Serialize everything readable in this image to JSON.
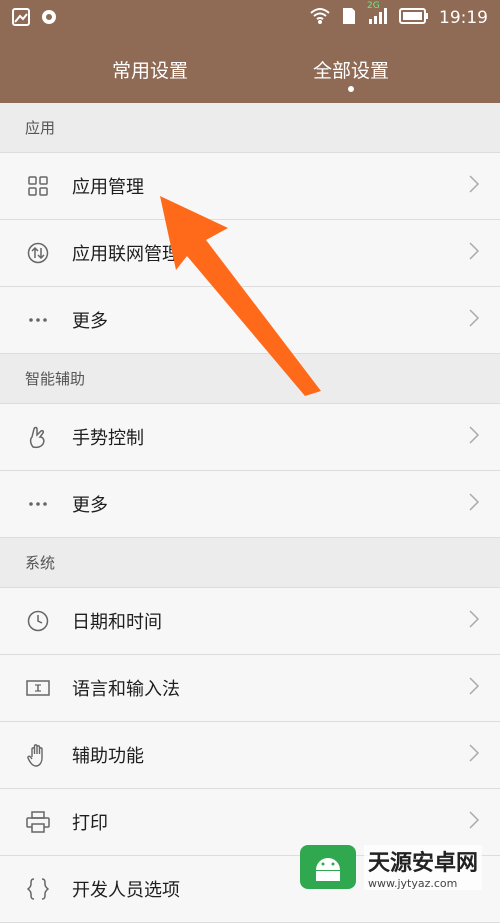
{
  "status_bar": {
    "time": "19:19",
    "network_label": "2G"
  },
  "tabs": [
    {
      "label": "常用设置",
      "active": false
    },
    {
      "label": "全部设置",
      "active": true
    }
  ],
  "sections": [
    {
      "title": "应用",
      "items": [
        {
          "label": "应用管理",
          "icon": "grid-icon"
        },
        {
          "label": "应用联网管理",
          "icon": "network-arrows-icon"
        },
        {
          "label": "更多",
          "icon": "more-dots-icon"
        }
      ]
    },
    {
      "title": "智能辅助",
      "items": [
        {
          "label": "手势控制",
          "icon": "gesture-hand-icon"
        },
        {
          "label": "更多",
          "icon": "more-dots-icon"
        }
      ]
    },
    {
      "title": "系统",
      "items": [
        {
          "label": "日期和时间",
          "icon": "clock-icon"
        },
        {
          "label": "语言和输入法",
          "icon": "keyboard-input-icon"
        },
        {
          "label": "辅助功能",
          "icon": "hand-icon"
        },
        {
          "label": "打印",
          "icon": "printer-icon"
        },
        {
          "label": "开发人员选项",
          "icon": "braces-icon"
        }
      ]
    }
  ],
  "watermark": {
    "title": "天源安卓网",
    "url": "www.jytyaz.com"
  },
  "colors": {
    "header_bg": "#8f6a55",
    "arrow": "#ff6a1a"
  }
}
